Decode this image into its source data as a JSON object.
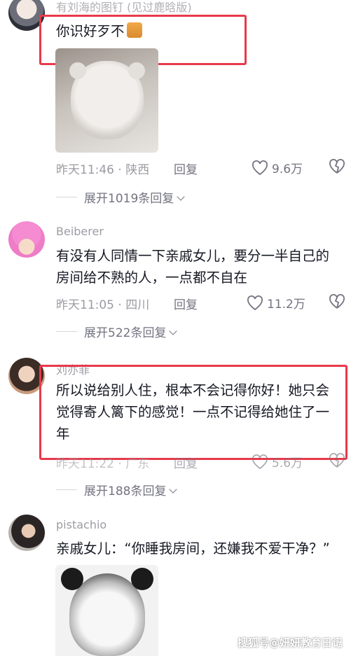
{
  "colors": {
    "highlight": "#e8394a",
    "meta": "#9b9ba3",
    "text": "#161823"
  },
  "comments": [
    {
      "username": "有刘海的图钉 (见过鹿晗版)",
      "text": "你识好歹不",
      "emoji_icon": "cat-emoji-icon",
      "has_image": true,
      "time": "昨天11:46",
      "location": "陕西",
      "reply_label": "回复",
      "likes": "9.6万",
      "expand": "展开1019条回复"
    },
    {
      "username": "Beiberer",
      "text": "有没有人同情一下亲戚女儿，要分一半自己的房间给不熟的人，一点都不自在",
      "time": "昨天11:05",
      "location": "四川",
      "reply_label": "回复",
      "likes": "11.2万",
      "expand": "展开522条回复"
    },
    {
      "username": "刘亦菲",
      "text": "所以说给别人住，根本不会记得你好！她只会觉得寄人篱下的感觉！一点不记得给她住了一年",
      "time": "昨天11:22",
      "location": "广东",
      "reply_label": "回复",
      "likes": "5.6万",
      "expand": "展开188条回复"
    },
    {
      "username": "pistachio",
      "text": "亲戚女儿：“你睡我房间，还嫌我不爱干净？”",
      "has_image": true
    }
  ],
  "watermark": "搜狐号@妍妍教育日记"
}
